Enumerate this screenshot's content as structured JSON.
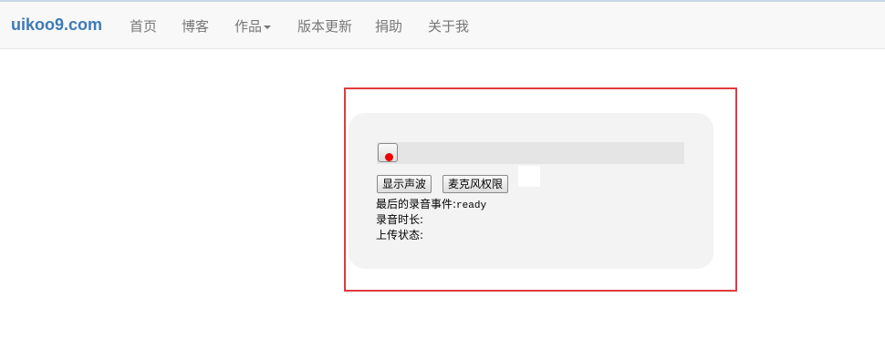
{
  "navbar": {
    "brand": "uikoo9.com",
    "items": [
      {
        "label": "首页"
      },
      {
        "label": "博客"
      },
      {
        "label": "作品"
      },
      {
        "label": "版本更新"
      },
      {
        "label": "捐助"
      },
      {
        "label": "关于我"
      }
    ]
  },
  "recorder": {
    "show_wave_label": "显示声波",
    "mic_permission_label": "麦克风权限",
    "last_event_label": "最后的录音事件:",
    "last_event_value": "ready",
    "duration_label": "录音时长:",
    "duration_value": "",
    "upload_label": "上传状态:",
    "upload_value": ""
  },
  "colors": {
    "brand": "#3c7ab7",
    "highlight_border": "#e03a3e",
    "record_dot": "#ee0000",
    "panel_bg": "#f3f3f3"
  }
}
